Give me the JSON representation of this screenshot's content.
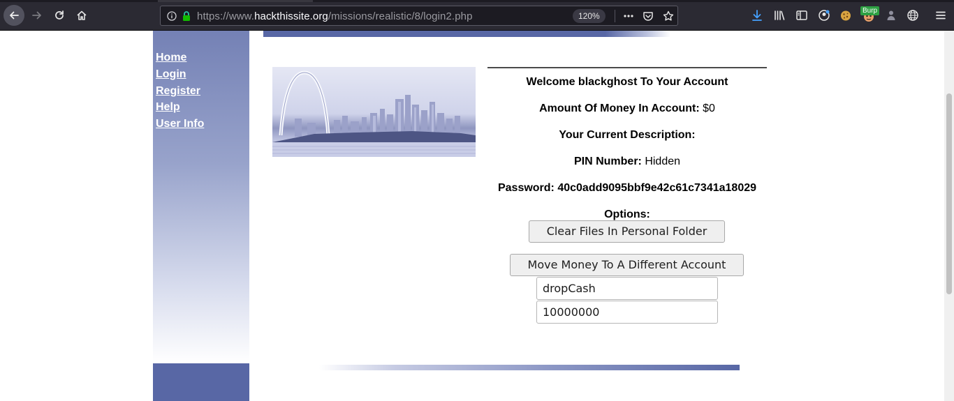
{
  "browser": {
    "url_prefix": "https://www.",
    "url_host": "hackthissite.org",
    "url_path": "/missions/realistic/8/login2.php",
    "zoom": "120%",
    "burp_label": "Burp"
  },
  "sidebar": {
    "items": [
      {
        "label": "Home"
      },
      {
        "label": "Login"
      },
      {
        "label": "Register"
      },
      {
        "label": "Help"
      },
      {
        "label": "User Info"
      }
    ]
  },
  "account": {
    "welcome": "Welcome blackghost To Your Account",
    "money_label": "Amount Of Money In Account:",
    "money_value": " $0",
    "description_label": "Your Current Description:",
    "pin_label": "PIN Number:",
    "pin_value": " Hidden",
    "password_label": "Password:",
    "password_value": " 40c0add9095bbf9e42c61c7341a18029",
    "options_label": "Options:"
  },
  "buttons": {
    "clear_files": "Clear Files In Personal Folder",
    "move_money": "Move Money To A Different Account"
  },
  "form": {
    "account_value": "dropCash",
    "amount_value": "10000000"
  },
  "colors": {
    "sidebar_accent": "#5867a5",
    "chrome_background": "#2b2a33"
  }
}
